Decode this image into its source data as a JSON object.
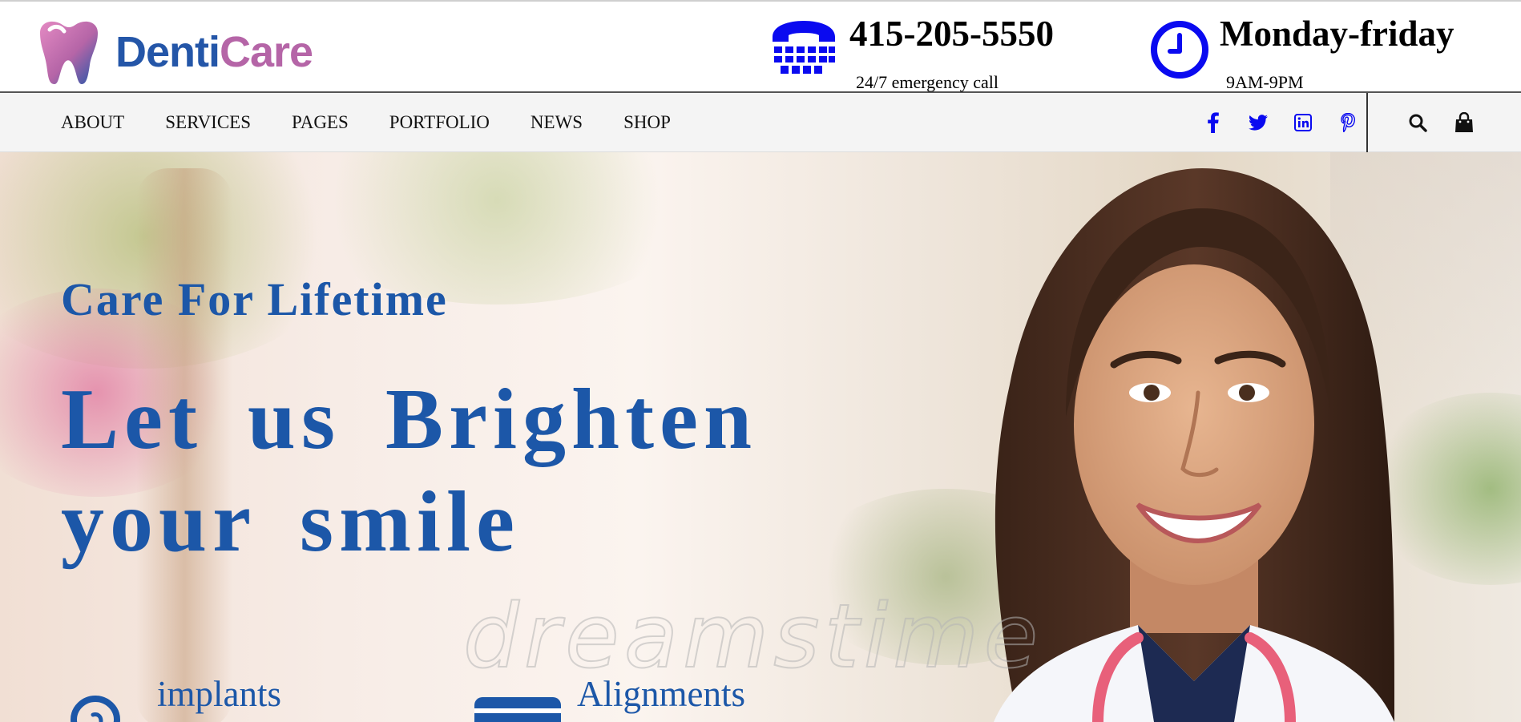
{
  "brand": {
    "name_part1": "Denti",
    "name_part2": "Care",
    "color_primary": "#2456a8",
    "color_secondary": "#b565a7"
  },
  "contact": {
    "phone": "415-205-5550",
    "phone_caption": "24/7 emergency call",
    "phone_icon": "telephone-icon",
    "hours_title": "Monday-friday",
    "hours_caption": "9AM-9PM",
    "hours_icon": "clock-icon"
  },
  "nav": {
    "items": [
      {
        "label": "ABOUT"
      },
      {
        "label": "SERVICES"
      },
      {
        "label": "PAGES"
      },
      {
        "label": "PORTFOLIO"
      },
      {
        "label": "NEWS"
      },
      {
        "label": "SHOP"
      }
    ],
    "social_icons": [
      "facebook-icon",
      "twitter-icon",
      "linkedin-icon",
      "pinterest-icon"
    ],
    "tool_icons": [
      "search-icon",
      "shopping-bag-icon"
    ]
  },
  "hero": {
    "kicker": "Care For Lifetime",
    "headline_line1": "Let us Brighten",
    "headline_line2": "your smile",
    "watermark": "dreamstime",
    "features": [
      {
        "label": "implants",
        "icon": "tooth-implant-icon"
      },
      {
        "label": "Alignments",
        "icon": "list-card-icon"
      }
    ],
    "accent_color": "#1c57a8"
  }
}
